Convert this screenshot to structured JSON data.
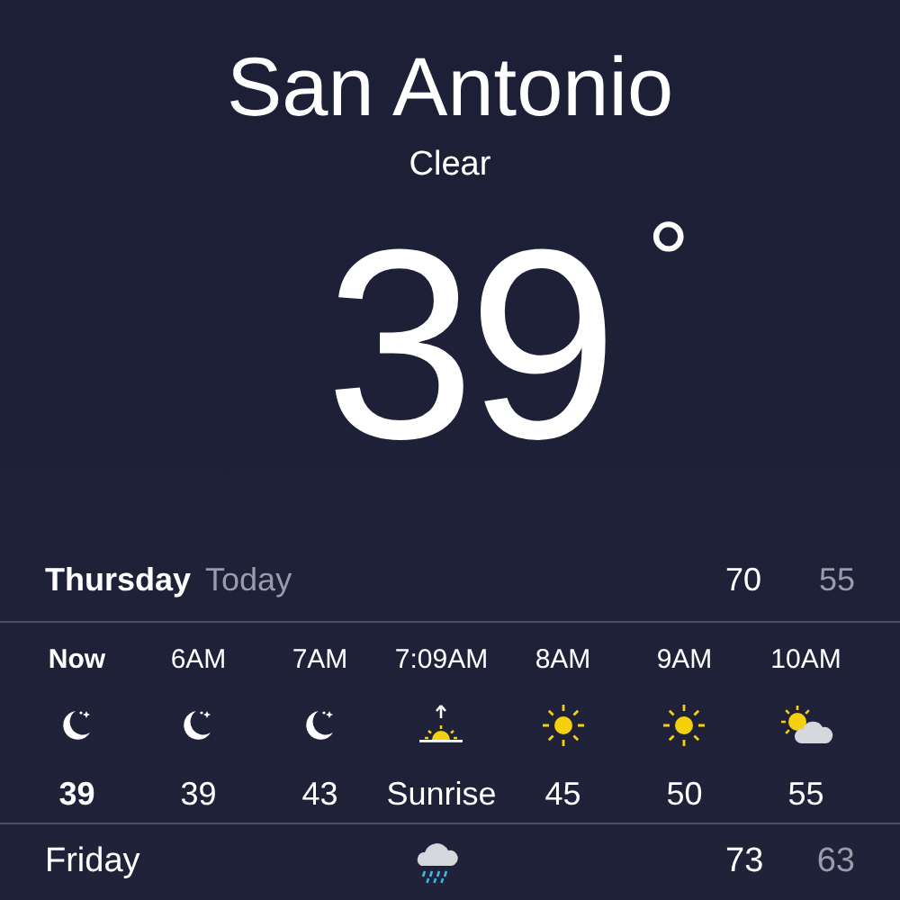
{
  "location": {
    "city": "San Antonio",
    "condition": "Clear",
    "temperature": "39",
    "degree": "°"
  },
  "today": {
    "day": "Thursday",
    "label": "Today",
    "high": "70",
    "low": "55"
  },
  "hourly": [
    {
      "time": "Now",
      "kind": "moon",
      "temp": "39",
      "current": true
    },
    {
      "time": "6AM",
      "kind": "moon",
      "temp": "39",
      "current": false
    },
    {
      "time": "7AM",
      "kind": "moon",
      "temp": "43",
      "current": false
    },
    {
      "time": "7:09AM",
      "kind": "sunrise",
      "temp": "Sunrise",
      "current": false
    },
    {
      "time": "8AM",
      "kind": "sun",
      "temp": "45",
      "current": false
    },
    {
      "time": "9AM",
      "kind": "sun",
      "temp": "50",
      "current": false
    },
    {
      "time": "10AM",
      "kind": "partly",
      "temp": "55",
      "current": false
    }
  ],
  "forecast": [
    {
      "day": "Friday",
      "kind": "rain",
      "high": "73",
      "low": "63"
    }
  ]
}
